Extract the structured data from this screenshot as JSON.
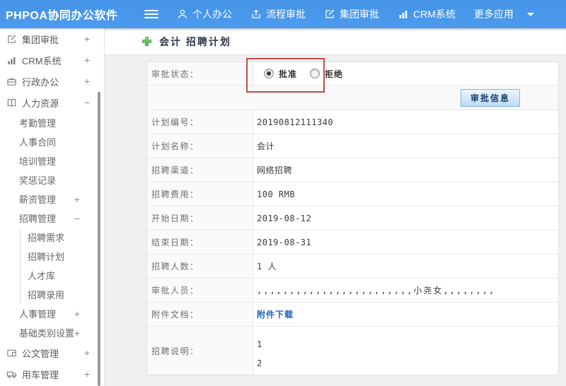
{
  "topbar": {
    "brand": "PHPOA协同办公软件",
    "nav": [
      {
        "icon": "user-icon",
        "label": "个人办公"
      },
      {
        "icon": "workflow-icon",
        "label": "流程审批"
      },
      {
        "icon": "edit-icon",
        "label": "集团审批"
      },
      {
        "icon": "bar-chart-icon",
        "label": "CRM系统"
      },
      {
        "icon": "caret-down-icon",
        "label": "更多应用"
      }
    ]
  },
  "sidebar": {
    "items": [
      {
        "label": "集团审批",
        "toggle": "+",
        "icon": "edit-square-icon"
      },
      {
        "label": "CRM系统",
        "toggle": "+",
        "icon": "bar-chart-icon"
      },
      {
        "label": "行政办公",
        "toggle": "+",
        "icon": "briefcase-icon"
      },
      {
        "label": "人力资源",
        "toggle": "−",
        "icon": "book-icon"
      },
      {
        "label": "考勤管理"
      },
      {
        "label": "人事合同"
      },
      {
        "label": "培训管理"
      },
      {
        "label": "奖惩记录"
      },
      {
        "label": "薪资管理",
        "toggle": "+"
      },
      {
        "label": "招聘管理",
        "toggle": "−"
      },
      {
        "label": "招聘需求"
      },
      {
        "label": "招聘计划"
      },
      {
        "label": "人才库"
      },
      {
        "label": "招聘录用"
      },
      {
        "label": "人事管理",
        "toggle": "+"
      },
      {
        "label": "基础类别设置",
        "toggle": "+"
      },
      {
        "label": "公文管理",
        "toggle": "+",
        "icon": "document-icon"
      },
      {
        "label": "用车管理",
        "toggle": "+",
        "icon": "truck-icon"
      }
    ]
  },
  "content": {
    "page_title": "会计 招聘计划",
    "status_row": {
      "label": "审批状态：",
      "radios": [
        {
          "label": "批准",
          "checked": true
        },
        {
          "label": "拒绝",
          "checked": false
        }
      ]
    },
    "approve_button": "审批信息",
    "rows": [
      {
        "label": "计划编号：",
        "value": "20190812111340"
      },
      {
        "label": "计划名称：",
        "value": "会计"
      },
      {
        "label": "招聘渠道：",
        "value": "网络招聘"
      },
      {
        "label": "招聘费用：",
        "value": "100 RMB"
      },
      {
        "label": "开始日期：",
        "value": "2019-08-12"
      },
      {
        "label": "结束日期：",
        "value": "2019-08-31"
      },
      {
        "label": "招聘人数：",
        "value": "1 人"
      },
      {
        "label": "审批人员：",
        "value": ",,,,,,,,,,,,,,,,,,,,,,,,小尧女,,,,,,,,"
      },
      {
        "label": "附件文档：",
        "value": "附件下载"
      },
      {
        "label": "招聘说明：",
        "line1": "1",
        "line2": "2"
      }
    ]
  },
  "colors": {
    "topbar_blue": "#4795e8",
    "annotation_red": "#bf4e4e",
    "link_blue": "#1c66c0",
    "plus_green": "#55b555",
    "button_border_blue": "#84b4e2",
    "content_bg": "#f0f0f0"
  }
}
